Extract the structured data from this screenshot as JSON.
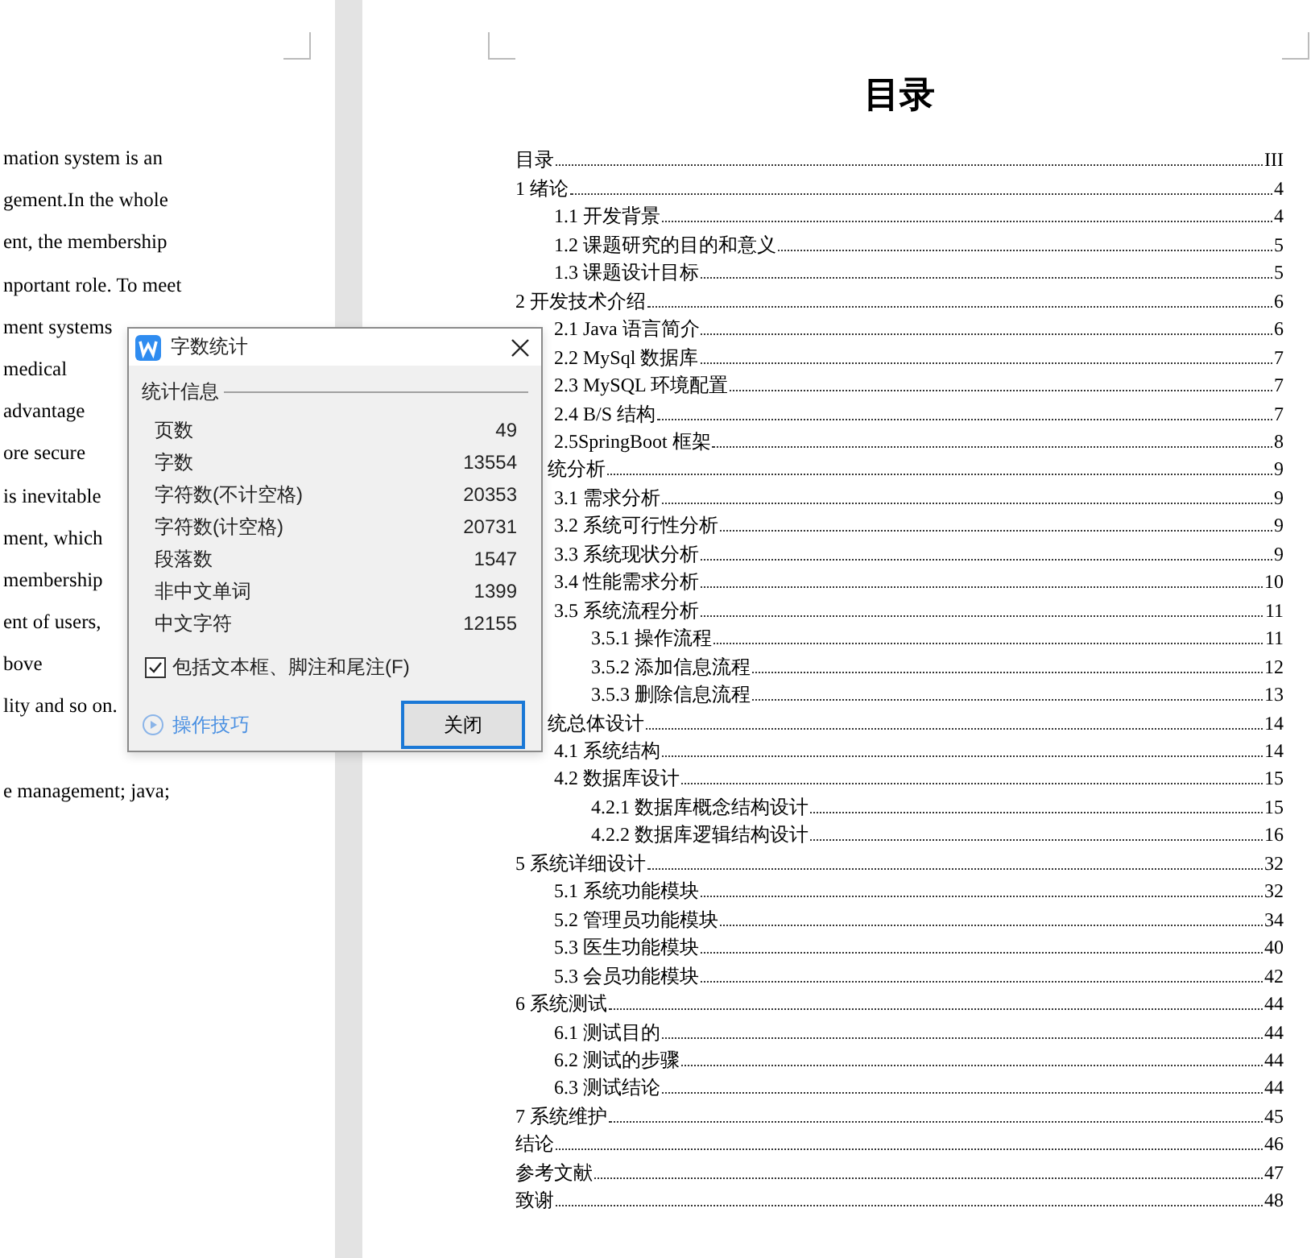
{
  "left_page": {
    "paragraphs": [
      [
        "mation system is an",
        "gement.In the whole",
        "ent, the membership",
        "nportant role. To meet",
        "ment systems",
        "medical",
        "advantage",
        "ore secure",
        "is inevitable",
        "ment, which",
        "membership",
        "ent of users,",
        "bove",
        "lity and so on."
      ],
      [
        "e management; java;"
      ]
    ]
  },
  "toc": {
    "title": "目录",
    "entries": [
      {
        "label": "目录",
        "page": "III",
        "partly_hidden": false
      },
      {
        "label": "1 绪论",
        "page": "4",
        "partly_hidden": false,
        "children": [
          {
            "label": "1.1 开发背景",
            "page": "4"
          },
          {
            "label": "1.2 课题研究的目的和意义",
            "page": "5"
          },
          {
            "label": "1.3 课题设计目标",
            "page": "5"
          }
        ]
      },
      {
        "label": "2 开发技术介绍",
        "page": "6",
        "partly_hidden": false,
        "children": [
          {
            "label": "2.1 Java 语言简介",
            "page": "6"
          },
          {
            "label": "2.2 MySql 数据库",
            "page": "7"
          },
          {
            "label": "2.3 MySQL 环境配置",
            "page": "7"
          },
          {
            "label": "2.4 B/S 结构",
            "page": "7"
          },
          {
            "label": "2.5SpringBoot 框架",
            "page": "8"
          }
        ]
      },
      {
        "label": "统分析",
        "page": "9",
        "partly_hidden": true,
        "children": [
          {
            "label": "3.1 需求分析",
            "page": "9"
          },
          {
            "label": "3.2 系统可行性分析",
            "page": "9"
          },
          {
            "label": "3.3  系统现状分析",
            "page": "9"
          },
          {
            "label": "3.4  性能需求分析",
            "page": "10"
          },
          {
            "label": "3.5 系统流程分析",
            "page": "11",
            "children": [
              {
                "label": "3.5.1 操作流程",
                "page": "11"
              },
              {
                "label": "3.5.2 添加信息流程",
                "page": "12"
              },
              {
                "label": "3.5.3 删除信息流程",
                "page": "13"
              }
            ]
          }
        ]
      },
      {
        "label": "统总体设计",
        "page": "14",
        "partly_hidden": true,
        "children": [
          {
            "label": "4.1 系统结构",
            "page": "14"
          },
          {
            "label": "4.2 数据库设计",
            "page": "15",
            "children": [
              {
                "label": "4.2.1  数据库概念结构设计",
                "page": "15"
              },
              {
                "label": "4.2.2 数据库逻辑结构设计",
                "page": "16"
              }
            ]
          }
        ]
      },
      {
        "label": "5  系统详细设计",
        "page": "32",
        "partly_hidden": false,
        "children": [
          {
            "label": "5.1 系统功能模块",
            "page": "32"
          },
          {
            "label": "5.2 管理员功能模块",
            "page": "34"
          },
          {
            "label": "5.3  医生功能模块",
            "page": "40"
          },
          {
            "label": "5.3  会员功能模块",
            "page": "42"
          }
        ]
      },
      {
        "label": "6  系统测试",
        "page": "44",
        "partly_hidden": false,
        "children": [
          {
            "label": "6.1  测试目的",
            "page": "44"
          },
          {
            "label": "6.2  测试的步骤",
            "page": "44"
          },
          {
            "label": "6.3 测试结论",
            "page": "44"
          }
        ]
      },
      {
        "label": "7  系统维护",
        "page": "45",
        "partly_hidden": false
      },
      {
        "label": "结论",
        "page": "46",
        "partly_hidden": false
      },
      {
        "label": "参考文献",
        "page": "47",
        "partly_hidden": false
      },
      {
        "label": "致谢",
        "page": "48",
        "partly_hidden": false
      }
    ]
  },
  "dialog": {
    "title": "字数统计",
    "group_label": "统计信息",
    "stats": [
      {
        "label": "页数",
        "value": "49"
      },
      {
        "label": "字数",
        "value": "13554"
      },
      {
        "label": "字符数(不计空格)",
        "value": "20353"
      },
      {
        "label": "字符数(计空格)",
        "value": "20731"
      },
      {
        "label": "段落数",
        "value": "1547"
      },
      {
        "label": "非中文单词",
        "value": "1399"
      },
      {
        "label": "中文字符",
        "value": "12155"
      }
    ],
    "checkbox": {
      "label": "包括文本框、脚注和尾注(F)",
      "checked": true
    },
    "tips_link": "操作技巧",
    "close_button": "关闭"
  }
}
